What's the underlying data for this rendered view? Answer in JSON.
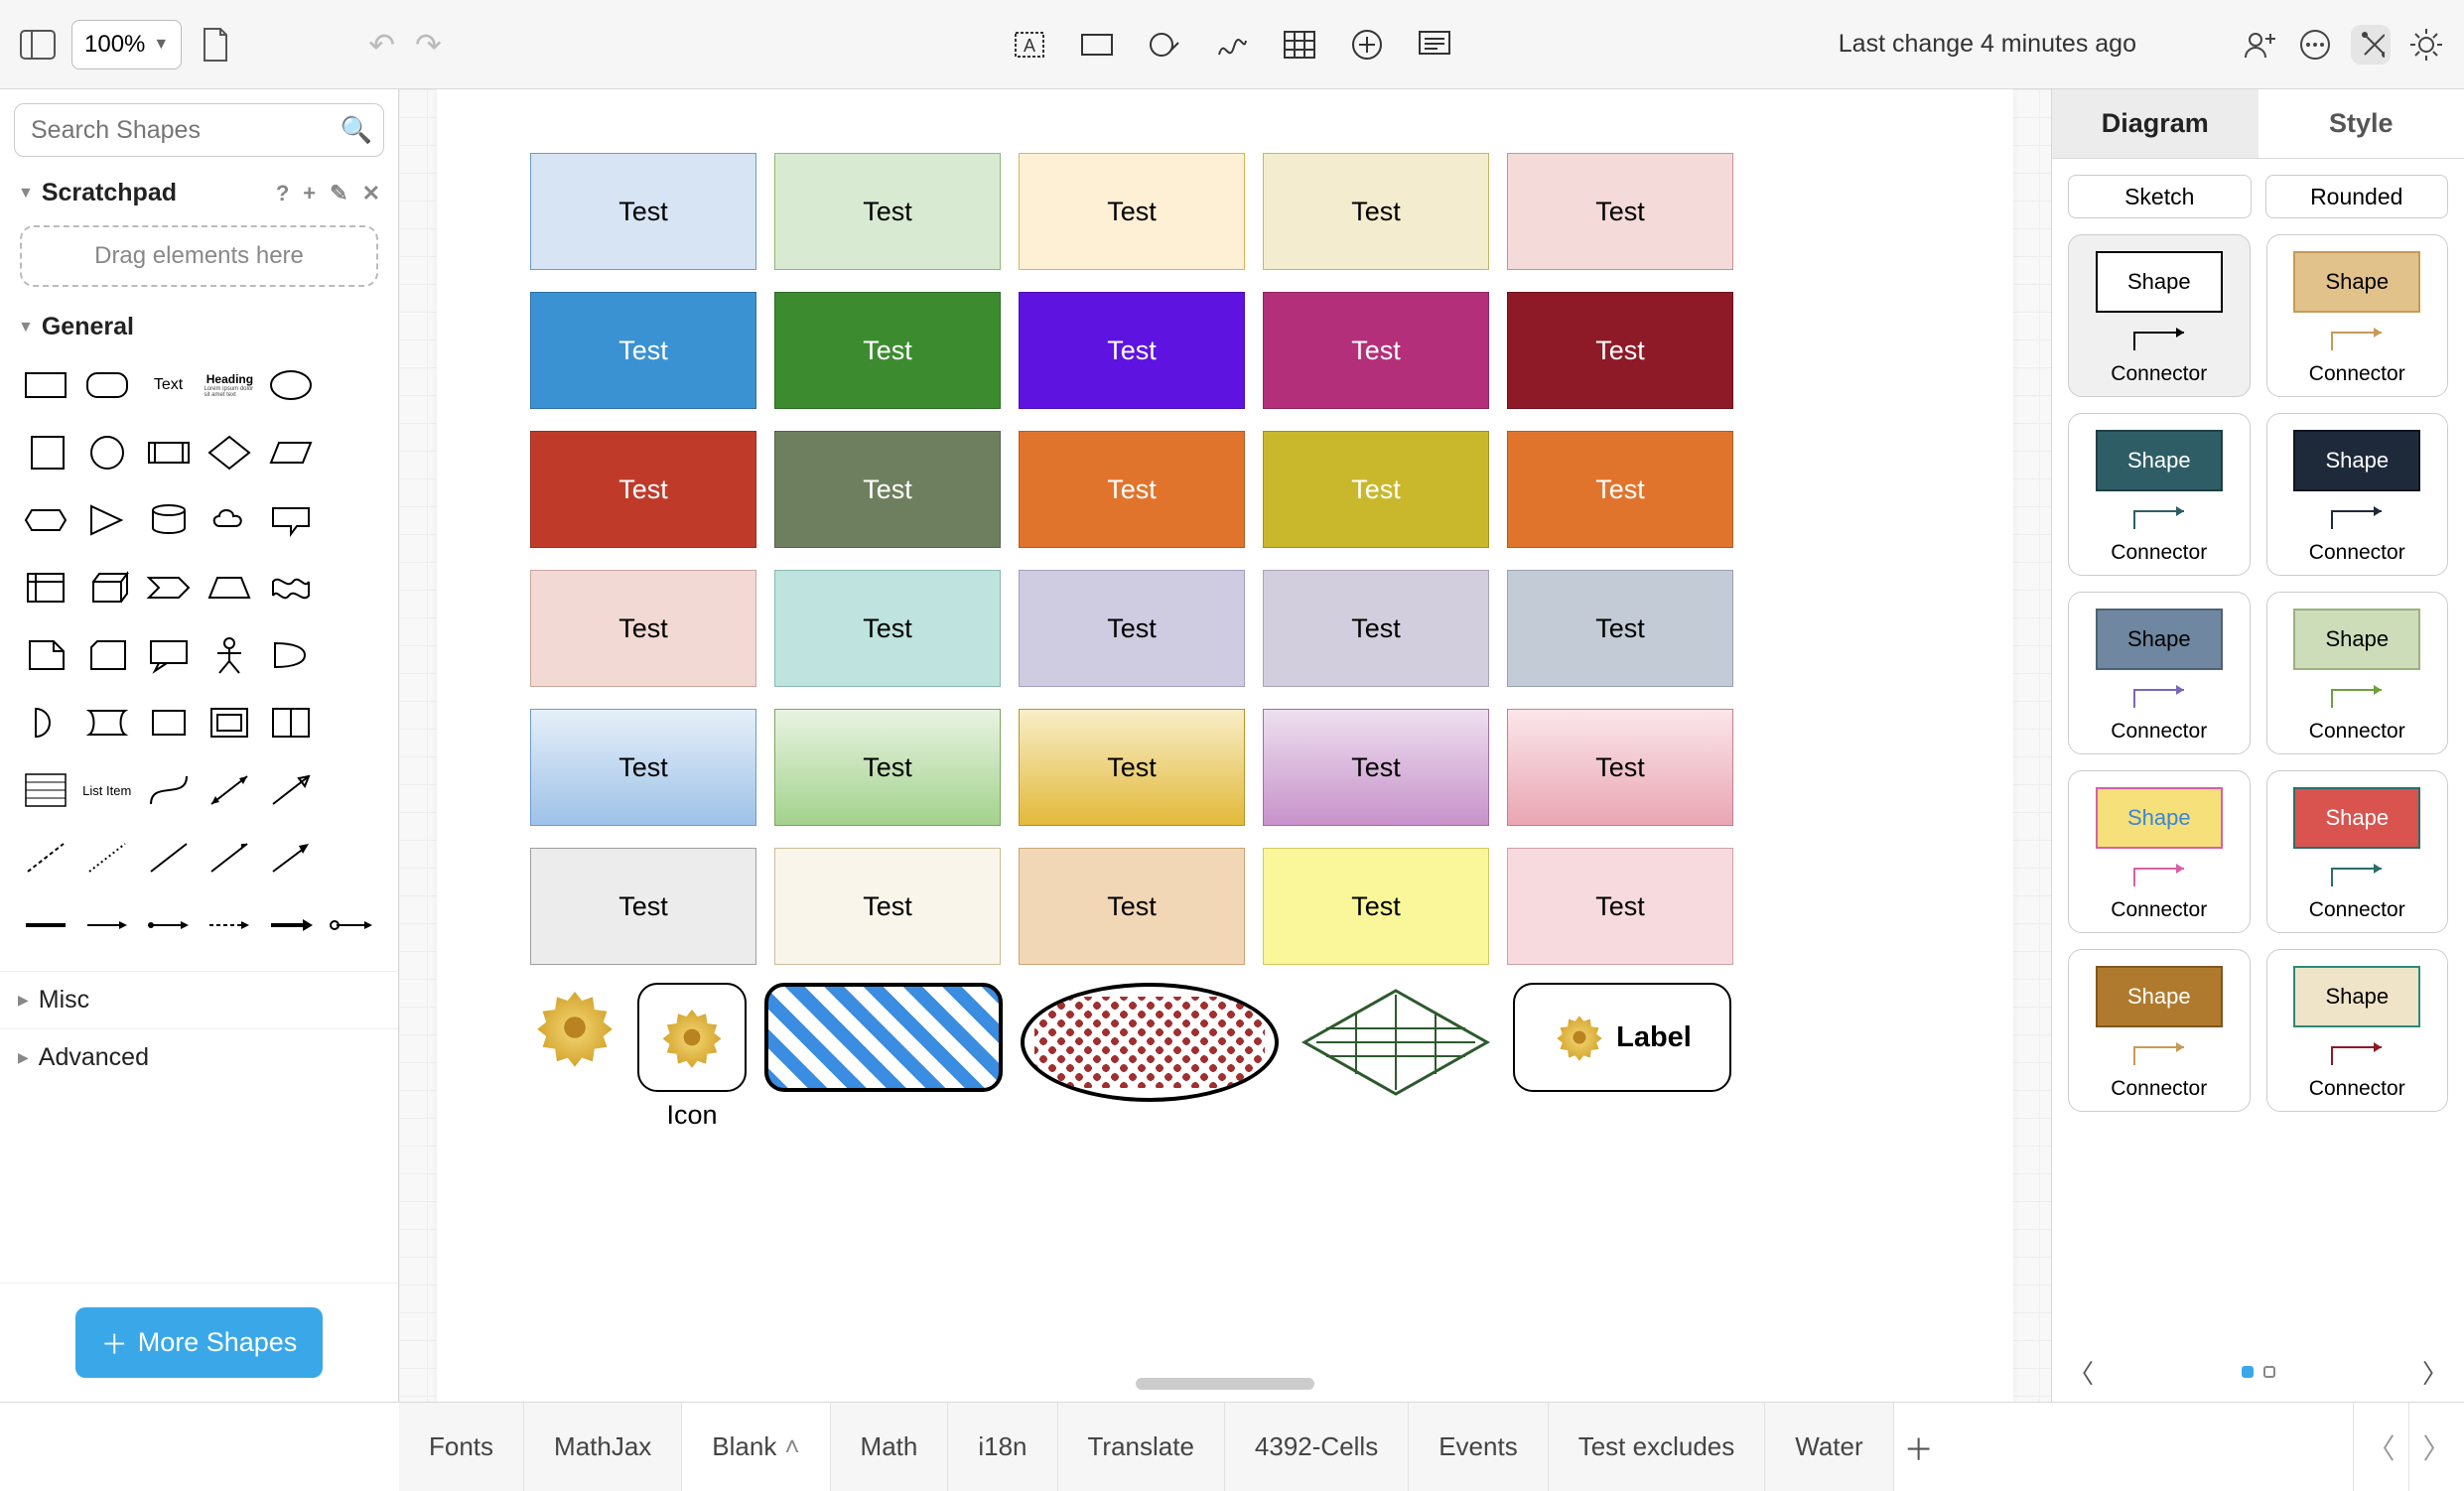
{
  "toolbar": {
    "zoom": "100%",
    "status": "Last change 4 minutes ago"
  },
  "search": {
    "placeholder": "Search Shapes"
  },
  "scratchpad": {
    "title": "Scratchpad",
    "drop_hint": "Drag elements here"
  },
  "general": {
    "title": "General",
    "text_label": "Text",
    "heading_label": "Heading",
    "list_item_label": "List Item"
  },
  "misc": {
    "title": "Misc"
  },
  "advanced": {
    "title": "Advanced"
  },
  "more_shapes": "More Shapes",
  "canvas": {
    "cell_text": "Test",
    "rows": [
      [
        {
          "bg": "#d7e4f4",
          "bd": "#6f99cf",
          "fg": "#000"
        },
        {
          "bg": "#d9ead3",
          "bd": "#8abb6e",
          "fg": "#000"
        },
        {
          "bg": "#fdf0d5",
          "bd": "#d8b656",
          "fg": "#000"
        },
        {
          "bg": "#f4ecce",
          "bd": "#c8b368",
          "fg": "#000"
        },
        {
          "bg": "#f5dada",
          "bd": "#ce8f8f",
          "fg": "#000"
        }
      ],
      [
        {
          "bg": "#3a92d3",
          "bd": "#2f6fa3",
          "fg": "#fff"
        },
        {
          "bg": "#3c8c2f",
          "bd": "#2e6b24",
          "fg": "#fff"
        },
        {
          "bg": "#5e13e0",
          "bd": "#4a0fb3",
          "fg": "#fff"
        },
        {
          "bg": "#b32f7a",
          "bd": "#8c2560",
          "fg": "#fff"
        },
        {
          "bg": "#8e1927",
          "bd": "#6c121d",
          "fg": "#fff"
        }
      ],
      [
        {
          "bg": "#c03a2a",
          "bd": "#962d20",
          "fg": "#fff"
        },
        {
          "bg": "#6e7f5f",
          "bd": "#55634a",
          "fg": "#fff"
        },
        {
          "bg": "#e1742c",
          "bd": "#b35b22",
          "fg": "#fff"
        },
        {
          "bg": "#c9b82c",
          "bd": "#9e9022",
          "fg": "#fff"
        },
        {
          "bg": "#e1742c",
          "bd": "#b35b22",
          "fg": "#fff"
        }
      ],
      [
        {
          "bg": "#f2d9d3",
          "bd": "#c9a69d",
          "fg": "#000"
        },
        {
          "bg": "#bfe3de",
          "bd": "#8bb8b2",
          "fg": "#000"
        },
        {
          "bg": "#cfcce2",
          "bd": "#a29fc0",
          "fg": "#000"
        },
        {
          "bg": "#d3cedd",
          "bd": "#a8a2b8",
          "fg": "#000"
        },
        {
          "bg": "#c3cbd6",
          "bd": "#97a2b2",
          "fg": "#000"
        }
      ],
      [
        {
          "g1": "#e6eff8",
          "g2": "#9ec2e8",
          "bd": "#6f99cf",
          "fg": "#000"
        },
        {
          "g1": "#e8f3e2",
          "g2": "#a3d28c",
          "bd": "#7ba75f",
          "fg": "#000"
        },
        {
          "g1": "#f8eec8",
          "g2": "#e2b93a",
          "bd": "#b8932a",
          "fg": "#000"
        },
        {
          "g1": "#eedfef",
          "g2": "#c792ca",
          "bd": "#a06ea4",
          "fg": "#000"
        },
        {
          "g1": "#fbe6ea",
          "g2": "#e9a6b3",
          "bd": "#c77e8d",
          "fg": "#000"
        }
      ],
      [
        {
          "bg": "#ececec",
          "bd": "#9e9e9e",
          "fg": "#000"
        },
        {
          "bg": "#faf5ea",
          "bd": "#cbbd99",
          "fg": "#000"
        },
        {
          "bg": "#f2d7b6",
          "bd": "#c9a476",
          "fg": "#000"
        },
        {
          "bg": "#faf79a",
          "bd": "#cfca5e",
          "fg": "#000"
        },
        {
          "bg": "#f6dadd",
          "bd": "#cfa1a6",
          "fg": "#000"
        }
      ]
    ],
    "icon_label": "Icon",
    "label_label": "Label"
  },
  "right": {
    "tab_diagram": "Diagram",
    "tab_style": "Style",
    "btn_sketch": "Sketch",
    "btn_rounded": "Rounded",
    "shape_label": "Shape",
    "conn_label": "Connector",
    "styles": [
      {
        "bg": "#ffffff",
        "bd": "#000000",
        "fg": "#000",
        "conn": "#000"
      },
      {
        "bg": "#e2c28b",
        "bd": "#c79a55",
        "fg": "#000",
        "conn": "#c79a55"
      },
      {
        "bg": "#2f5d66",
        "bd": "#1f3f45",
        "fg": "#fff",
        "conn": "#2f5d66"
      },
      {
        "bg": "#1e2a3a",
        "bd": "#0f1620",
        "fg": "#fff",
        "conn": "#1e2a3a"
      },
      {
        "bg": "#6f87a0",
        "bd": "#4e6276",
        "fg": "#000",
        "conn": "#7a67b8"
      },
      {
        "bg": "#cdddb9",
        "bd": "#9cb082",
        "fg": "#000",
        "conn": "#6fa03c"
      },
      {
        "bg": "#f6e07a",
        "bd": "#d95fa7",
        "fg": "#3a86d8",
        "conn": "#d95fa7"
      },
      {
        "bg": "#d9534f",
        "bd": "#2b6e6a",
        "fg": "#fff",
        "conn": "#2b6e6a"
      },
      {
        "bg": "#b07a2e",
        "bd": "#7e5720",
        "fg": "#fff",
        "conn": "#c79a55"
      },
      {
        "bg": "#efe4c8",
        "bd": "#2b8a7a",
        "fg": "#000",
        "conn": "#8e1927"
      }
    ]
  },
  "tabs": {
    "items": [
      "Fonts",
      "MathJax",
      "Blank",
      "Math",
      "i18n",
      "Translate",
      "4392-Cells",
      "Events",
      "Test excludes",
      "Water"
    ],
    "active_index": 2
  }
}
